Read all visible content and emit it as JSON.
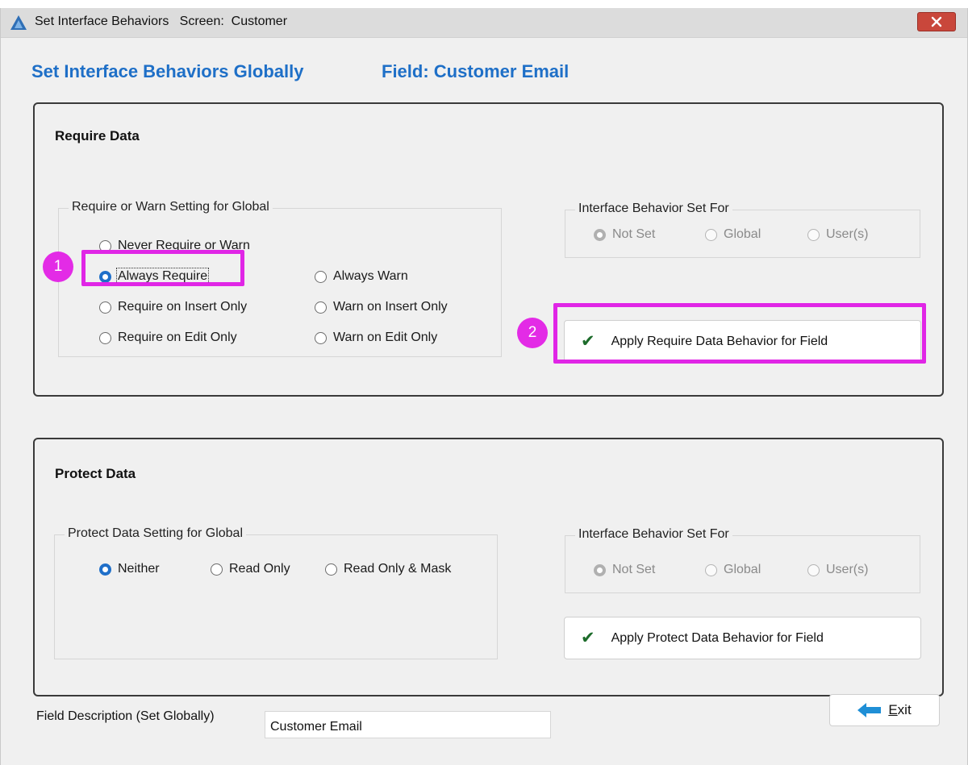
{
  "window": {
    "title": "Set Interface Behaviors   Screen:  Customer",
    "icon": "app-logo-icon",
    "close_icon": "close-icon"
  },
  "header": {
    "title": "Set Interface Behaviors Globally",
    "field": "Field:  Customer Email"
  },
  "require": {
    "title": "Require Data",
    "setting_legend": "Require or Warn Setting for Global",
    "options": {
      "never": "Never Require or Warn",
      "always_require": "Always Require",
      "always_warn": "Always Warn",
      "require_insert": "Require on Insert Only",
      "warn_insert": "Warn on Insert Only",
      "require_edit": "Require on Edit Only",
      "warn_edit": "Warn on Edit Only"
    },
    "selected": "always_require",
    "behavior_legend": "Interface Behavior Set For",
    "behavior_options": [
      "Not Set",
      "Global",
      "User(s)"
    ],
    "behavior_selected": "Not Set",
    "apply_label": "Apply Require Data Behavior for Field"
  },
  "protect": {
    "title": "Protect Data",
    "setting_legend": "Protect Data Setting for Global",
    "options": [
      "Neither",
      "Read Only",
      "Read Only & Mask"
    ],
    "selected": "Neither",
    "behavior_legend": "Interface Behavior Set For",
    "behavior_options": [
      "Not Set",
      "Global",
      "User(s)"
    ],
    "behavior_selected": "Not Set",
    "apply_label": "Apply Protect Data Behavior for Field"
  },
  "annotations": {
    "badge1": "1",
    "badge2": "2",
    "highlight_color": "#e026e6"
  },
  "footer": {
    "description_label": "Field Description (Set Globally)",
    "description_value": "Customer Email",
    "exit_label": "Exit"
  },
  "colors": {
    "accent": "#1e6fc7",
    "check": "#1c6b2a"
  }
}
